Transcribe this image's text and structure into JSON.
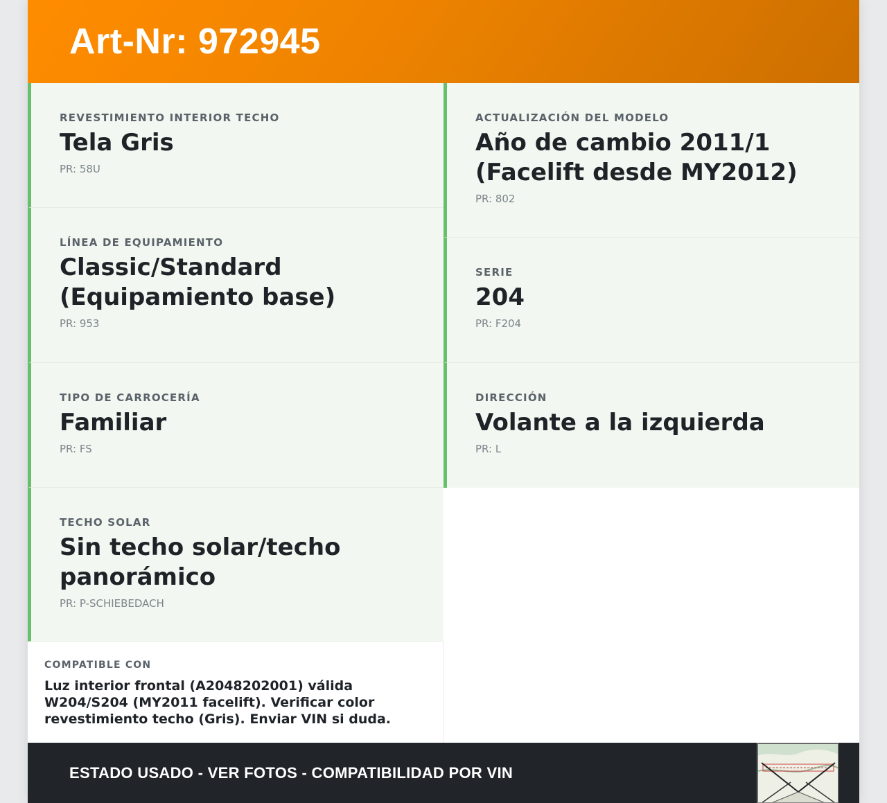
{
  "header": {
    "title": "Art-Nr: 972945"
  },
  "specs": {
    "left": [
      {
        "label": "Revestimiento interior techo",
        "value": "Tela Gris",
        "code": "PR: 58U"
      },
      {
        "label": "Línea de equipamiento",
        "value": "Classic/Standard (Equipamiento base)",
        "code": "PR: 953"
      },
      {
        "label": "Tipo de carrocería",
        "value": "Familiar",
        "code": "PR: FS"
      },
      {
        "label": "Techo solar",
        "value": "Sin techo solar/techo panorámico",
        "code": "PR: P-SCHIEBEDACH"
      }
    ],
    "right": [
      {
        "label": "Actualización del modelo",
        "value": "Año de cambio 2011/1 (Facelift desde MY2012)",
        "code": "PR: 802"
      },
      {
        "label": "Serie",
        "value": "204",
        "code": "PR: F204"
      },
      {
        "label": "Dirección",
        "value": "Volante a la izquierda",
        "code": "PR: L"
      }
    ]
  },
  "compat": {
    "label": "COMPATIBLE CON",
    "text": "Luz interior frontal (A2048202001) válida W204/S204 (MY2011 facelift). Verificar color revestimiento techo (Gris). Enviar VIN si duda."
  },
  "footer": {
    "status": "ESTADO USADO - VER FOTOS - COMPATIBILIDAD POR VIN"
  },
  "colors": {
    "accent": "#ff8c00",
    "accent_dark": "#cc6f00",
    "cell_border": "#67bf6c",
    "cell_bg": "#f2f8f1",
    "footer_bg": "#212428"
  }
}
